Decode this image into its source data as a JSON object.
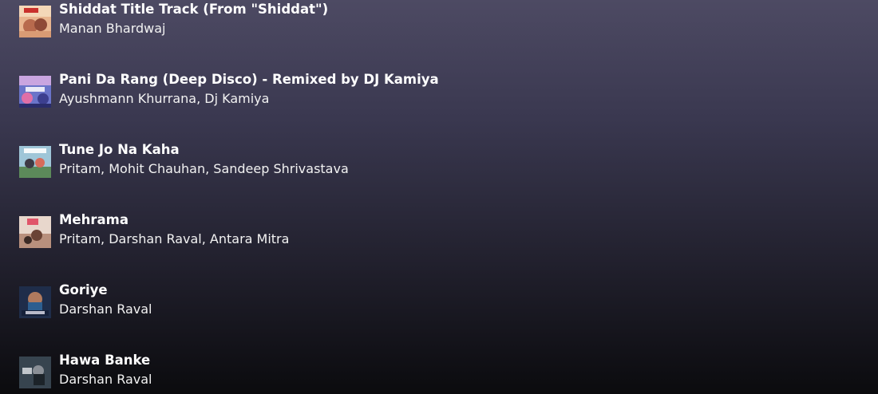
{
  "tracks": [
    {
      "title": "Shiddat Title Track (From \"Shiddat\")",
      "artist": "Manan Bhardwaj",
      "cover_icon": "album-cover-shiddat"
    },
    {
      "title": "Pani Da Rang (Deep Disco) - Remixed by DJ Kamiya",
      "artist": "Ayushmann Khurrana, Dj Kamiya",
      "cover_icon": "album-cover-pani-da-rang"
    },
    {
      "title": "Tune Jo Na Kaha",
      "artist": "Pritam, Mohit Chauhan, Sandeep Shrivastava",
      "cover_icon": "album-cover-new-york"
    },
    {
      "title": "Mehrama",
      "artist": "Pritam, Darshan Raval, Antara Mitra",
      "cover_icon": "album-cover-love-aaj-kal"
    },
    {
      "title": "Goriye",
      "artist": "Darshan Raval",
      "cover_icon": "album-cover-goriye"
    },
    {
      "title": "Hawa Banke",
      "artist": "Darshan Raval",
      "cover_icon": "album-cover-hawa-banke"
    }
  ],
  "colors": {
    "background_top": "#4d4a63",
    "background_bottom": "#0b0b0e",
    "text_primary": "#ffffff"
  }
}
